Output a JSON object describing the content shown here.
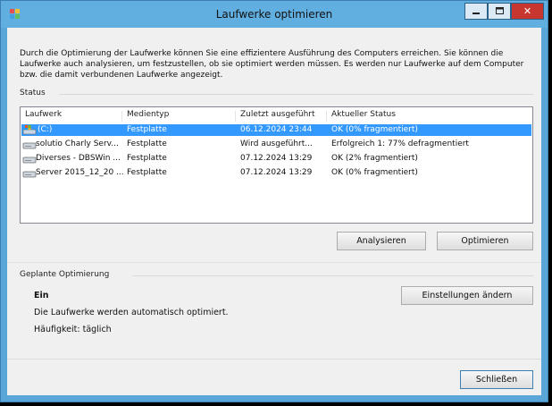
{
  "window": {
    "title": "Laufwerke optimieren"
  },
  "intro_text": "Durch die Optimierung der Laufwerke können Sie eine effizientere Ausführung des Computers erreichen. Sie können die Laufwerke auch analysieren, um festzustellen, ob sie optimiert werden müssen. Es werden nur Laufwerke auf dem Computer bzw. die damit verbundenen Laufwerke angezeigt.",
  "status": {
    "label": "Status",
    "columns": [
      "Laufwerk",
      "Medientyp",
      "Zuletzt ausgeführt",
      "Aktueller Status"
    ],
    "rows": [
      {
        "drive": "(C:)",
        "media": "Festplatte",
        "last_run": "06.12.2024 23:44",
        "status": "OK (0% fragmentiert)",
        "selected": true,
        "icon": "system-drive-icon"
      },
      {
        "drive": "solutio Charly Serv...",
        "media": "Festplatte",
        "last_run": "Wird ausgeführt...",
        "status": "Erfolgreich 1: 77% defragmentiert",
        "selected": false,
        "icon": "drive-icon"
      },
      {
        "drive": "Diverses - DBSWin ...",
        "media": "Festplatte",
        "last_run": "07.12.2024 13:29",
        "status": "OK (2% fragmentiert)",
        "selected": false,
        "icon": "drive-icon"
      },
      {
        "drive": "Server 2015_12_20 ...",
        "media": "Festplatte",
        "last_run": "07.12.2024 13:29",
        "status": "OK (0% fragmentiert)",
        "selected": false,
        "icon": "drive-icon"
      }
    ],
    "analyze_label": "Analysieren",
    "optimize_label": "Optimieren"
  },
  "schedule": {
    "label": "Geplante Optimierung",
    "state": "Ein",
    "description": "Die Laufwerke werden automatisch optimiert.",
    "frequency": "Häufigkeit: täglich",
    "change_settings_label": "Einstellungen ändern"
  },
  "close_label": "Schließen",
  "colors": {
    "titlebar": "#61aee0",
    "selection": "#3399ff",
    "close": "#c7372f"
  }
}
